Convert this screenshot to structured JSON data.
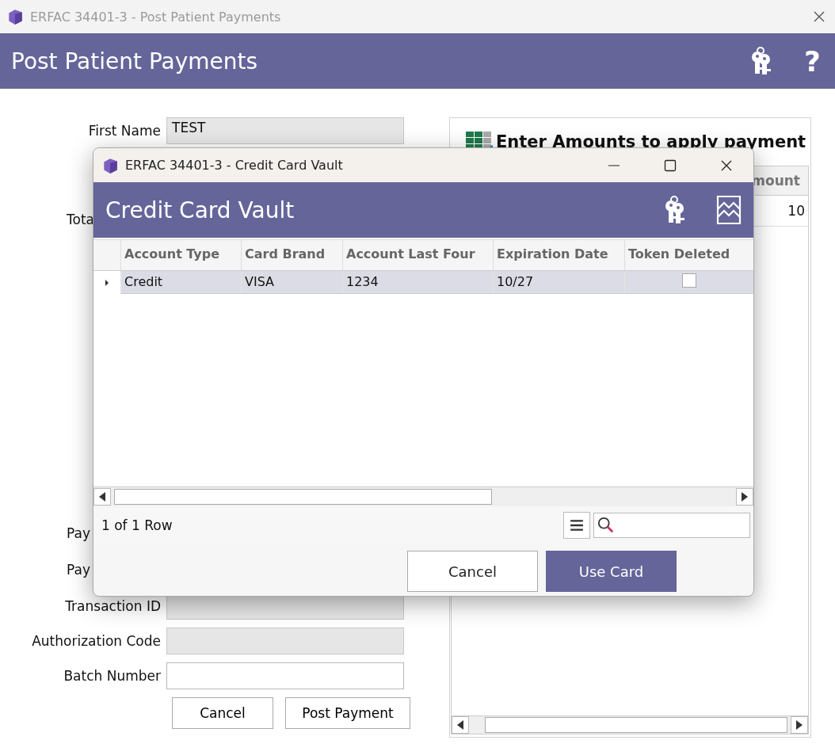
{
  "main_window": {
    "title": "ERFAC 34401-3 - Post Patient Payments",
    "header": "Post Patient Payments",
    "help_symbol": "?"
  },
  "form": {
    "fields": [
      {
        "kind": "field",
        "label": "First Name",
        "value": "TEST",
        "disabled": true
      },
      {
        "kind": "cut",
        "label": "Tota"
      },
      {
        "kind": "cut",
        "label": "Pay"
      },
      {
        "kind": "cut",
        "label": "Pay"
      },
      {
        "kind": "field",
        "label": "Transaction ID",
        "disabled": true
      },
      {
        "kind": "field",
        "label": "Authorization Code",
        "disabled": true
      },
      {
        "kind": "field",
        "label": "Batch Number",
        "disabled": false
      }
    ],
    "buttons": [
      "Cancel",
      "Post Payment"
    ]
  },
  "amounts_panel": {
    "title": "Enter Amounts to apply payment",
    "column": "mount",
    "cell": "10"
  },
  "dialog": {
    "title": "ERFAC 34401-3 - Credit Card Vault",
    "header": "Credit Card Vault",
    "columns": [
      "Account Type",
      "Card Brand",
      "Account Last Four",
      "Expiration Date",
      "Token Deleted"
    ],
    "rows": [
      {
        "selected": true,
        "account_type": "Credit",
        "card_brand": "VISA",
        "last_four": "1234",
        "expiration": "10/27",
        "token_deleted": false
      }
    ],
    "row_count": "1 of 1 Row",
    "buttons": [
      "Cancel",
      "Use Card"
    ]
  }
}
